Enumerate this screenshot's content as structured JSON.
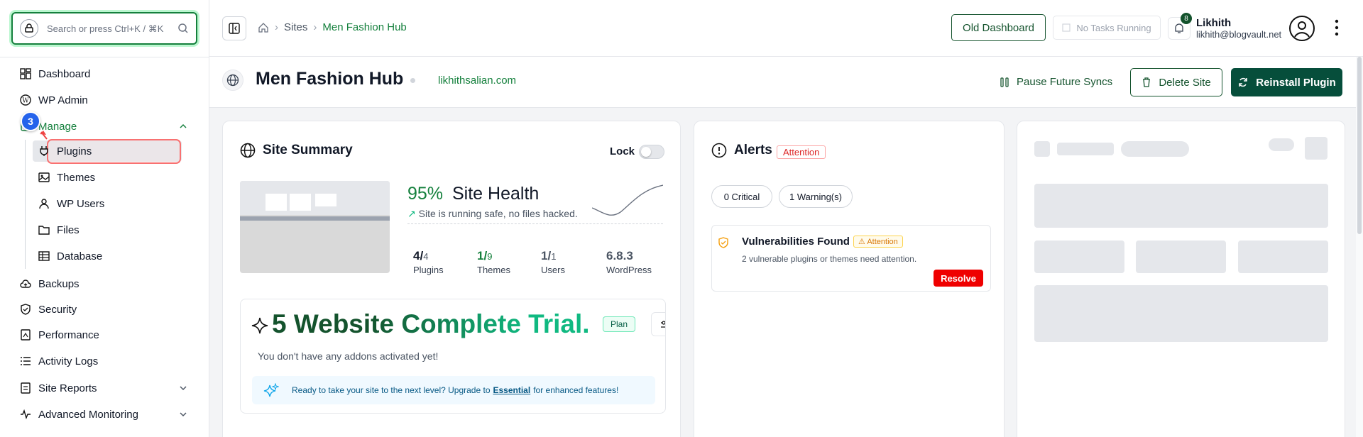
{
  "search": {
    "placeholder": "Search or press Ctrl+K / ⌘K"
  },
  "sidebar": {
    "items": [
      {
        "label": "Dashboard",
        "icon": "dashboard-icon"
      },
      {
        "label": "WP Admin",
        "icon": "wordpress-icon"
      },
      {
        "label": "Manage",
        "icon": "manage-icon"
      },
      {
        "label": "Plugins",
        "icon": "plug-icon"
      },
      {
        "label": "Themes",
        "icon": "image-icon"
      },
      {
        "label": "WP Users",
        "icon": "user-icon"
      },
      {
        "label": "Files",
        "icon": "folder-icon"
      },
      {
        "label": "Database",
        "icon": "table-icon"
      },
      {
        "label": "Backups",
        "icon": "cloud-icon"
      },
      {
        "label": "Security",
        "icon": "shield-icon"
      },
      {
        "label": "Performance",
        "icon": "gauge-icon"
      },
      {
        "label": "Activity Logs",
        "icon": "list-icon"
      },
      {
        "label": "Site Reports",
        "icon": "report-icon"
      },
      {
        "label": "Advanced Monitoring",
        "icon": "pulse-icon"
      }
    ],
    "step_badge": "3"
  },
  "header": {
    "breadcrumbs": [
      "Sites",
      "Men Fashion Hub"
    ],
    "old_dashboard": "Old Dashboard",
    "tasks": "No Tasks Running",
    "notifications": "8",
    "user_name": "Likhith",
    "user_email": "likhith@blogvault.net"
  },
  "site": {
    "title": "Men Fashion Hub",
    "domain": "likhithsalian.com",
    "pause": "Pause Future Syncs",
    "delete": "Delete Site",
    "reinstall": "Reinstall Plugin"
  },
  "summary": {
    "title": "Site Summary",
    "lock": "Lock",
    "health_pct": "95%",
    "health_label": "Site Health",
    "health_msg": "Site is running safe, no files hacked.",
    "stats": [
      {
        "num": "4/",
        "den": "4",
        "label": "Plugins"
      },
      {
        "num": "1/",
        "den": "9",
        "label": "Themes"
      },
      {
        "num": "1/",
        "den": "1",
        "label": "Users"
      },
      {
        "num": "6.8.3",
        "den": "",
        "label": "WordPress"
      }
    ],
    "plan_title": "5 Website Complete Trial.",
    "plan_badge": "Plan",
    "addons": "You don't have any addons activated yet!",
    "upgrade_pre": "Ready to take your site to the next level? Upgrade to",
    "upgrade_link": "Essential",
    "upgrade_post": "for enhanced features!"
  },
  "alerts": {
    "title": "Alerts",
    "tag": "Attention",
    "critical": "0 Critical",
    "warnings": "1 Warning(s)",
    "vuln_title": "Vulnerabilities Found",
    "vuln_tag": "Attention",
    "vuln_msg": "2 vulnerable plugins or themes need attention.",
    "resolve": "Resolve"
  },
  "colors": {
    "brand": "#14532d",
    "accent": "#15803d",
    "danger": "#ef0000"
  }
}
